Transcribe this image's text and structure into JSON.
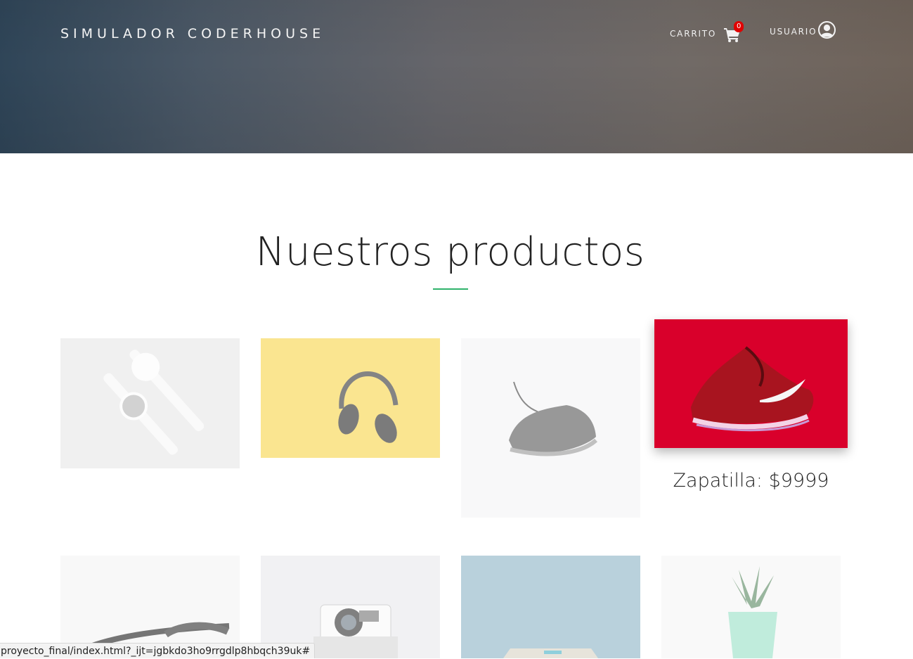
{
  "header": {
    "brand": "SIMULADOR CODERHOUSE",
    "cart_label": "CARRITO",
    "cart_count": "0",
    "user_label": "USUARIO"
  },
  "products_section": {
    "title": "Nuestros productos",
    "active_caption": "Zapatilla: $9999"
  },
  "status_bar": {
    "url": "proyecto_final/index.html?_ijt=jgbkdo3ho9rrgdlp8hbqch39uk#"
  },
  "colors": {
    "accent_underline": "#2fb36b",
    "badge": "#e00000"
  }
}
